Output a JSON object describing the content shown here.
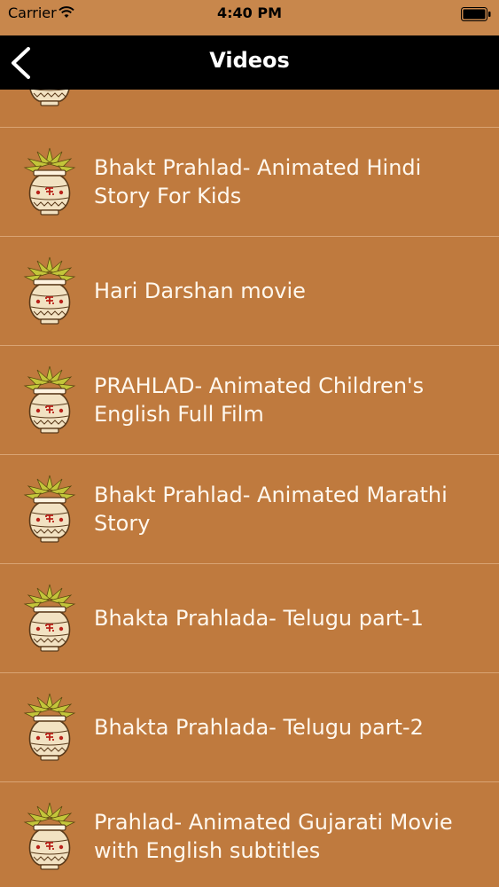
{
  "status_bar": {
    "carrier": "Carrier",
    "time": "4:40 PM"
  },
  "nav": {
    "title": "Videos",
    "back_icon": "chevron-left-icon"
  },
  "colors": {
    "background": "#bf7a3e",
    "nav": "#000000",
    "row_text": "#fff8ee",
    "divider": "#d9a474"
  },
  "videos": [
    {
      "title": ""
    },
    {
      "title": "Bhakt Prahlad- Animated Hindi Story For Kids"
    },
    {
      "title": "Hari Darshan movie"
    },
    {
      "title": "PRAHLAD- Animated Children's English Full Film"
    },
    {
      "title": "Bhakt Prahlad- Animated Marathi Story"
    },
    {
      "title": "Bhakta Prahlada- Telugu part-1"
    },
    {
      "title": "Bhakta Prahlada- Telugu part-2"
    },
    {
      "title": "Prahlad- Animated Gujarati Movie with English subtitles"
    }
  ]
}
